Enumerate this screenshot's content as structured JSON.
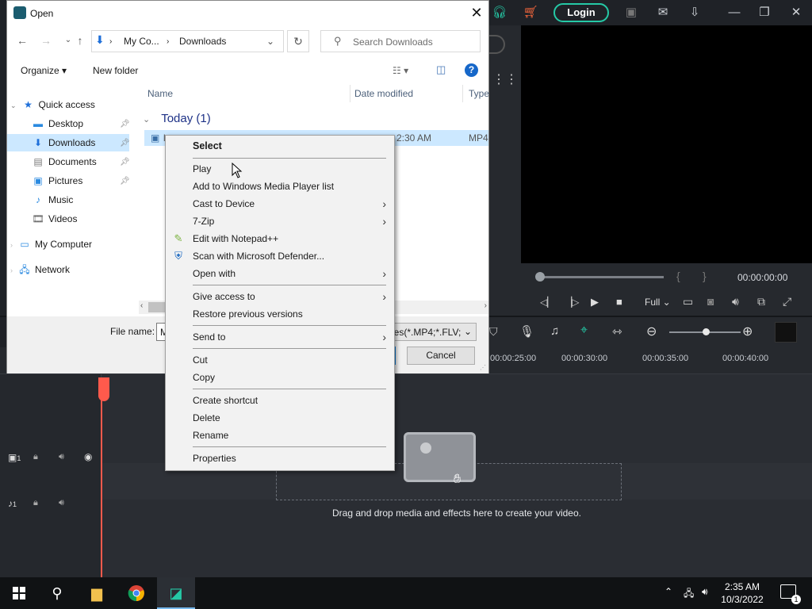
{
  "editor": {
    "login_label": "Login",
    "timecode": "00:00:00:00",
    "quality": "Full",
    "ruler_ticks": [
      "00:00:25:00",
      "00:00:30:00",
      "00:00:35:00",
      "00:00:40:00"
    ],
    "video_track_label": "1",
    "audio_track_label": "1",
    "drop_hint": "Drag and drop media and effects here to create your video.",
    "accent_color": "#25c9a6"
  },
  "dialog": {
    "title": "Open",
    "breadcrumb": [
      "My Co...",
      "Downloads"
    ],
    "search_placeholder": "Search Downloads",
    "organize_label": "Organize",
    "new_folder_label": "New folder",
    "nav": {
      "quick_access": "Quick access",
      "items": [
        "Desktop",
        "Downloads",
        "Documents",
        "Pictures",
        "Music",
        "Videos"
      ],
      "my_computer": "My Computer",
      "network": "Network"
    },
    "columns": {
      "name": "Name",
      "date": "Date modified",
      "type": "Type"
    },
    "group": "Today (1)",
    "file": {
      "name": "l",
      "time": "2:30 AM",
      "type": "MP4"
    },
    "file_name_label": "File name:",
    "file_name_value": "M",
    "file_type_value": "les(*.MP4;*.FLV;",
    "cancel_label": "Cancel"
  },
  "context_menu": {
    "items": [
      {
        "label": "Select",
        "bold": true
      },
      {
        "label": "Play"
      },
      {
        "label": "Add to Windows Media Player list"
      },
      {
        "label": "Cast to Device",
        "submenu": true
      },
      {
        "label": "7-Zip",
        "submenu": true
      },
      {
        "label": "Edit with Notepad++",
        "icon": "notepad-plus-plus-icon"
      },
      {
        "label": "Scan with Microsoft Defender...",
        "icon": "defender-shield-icon"
      },
      {
        "label": "Open with",
        "submenu": true
      },
      {
        "label": "Give access to",
        "submenu": true
      },
      {
        "label": "Restore previous versions"
      },
      {
        "label": "Send to",
        "submenu": true
      },
      {
        "label": "Cut"
      },
      {
        "label": "Copy"
      },
      {
        "label": "Create shortcut"
      },
      {
        "label": "Delete"
      },
      {
        "label": "Rename"
      },
      {
        "label": "Properties"
      }
    ]
  },
  "taskbar": {
    "time": "2:35 AM",
    "date": "10/3/2022",
    "notification_count": "1"
  }
}
